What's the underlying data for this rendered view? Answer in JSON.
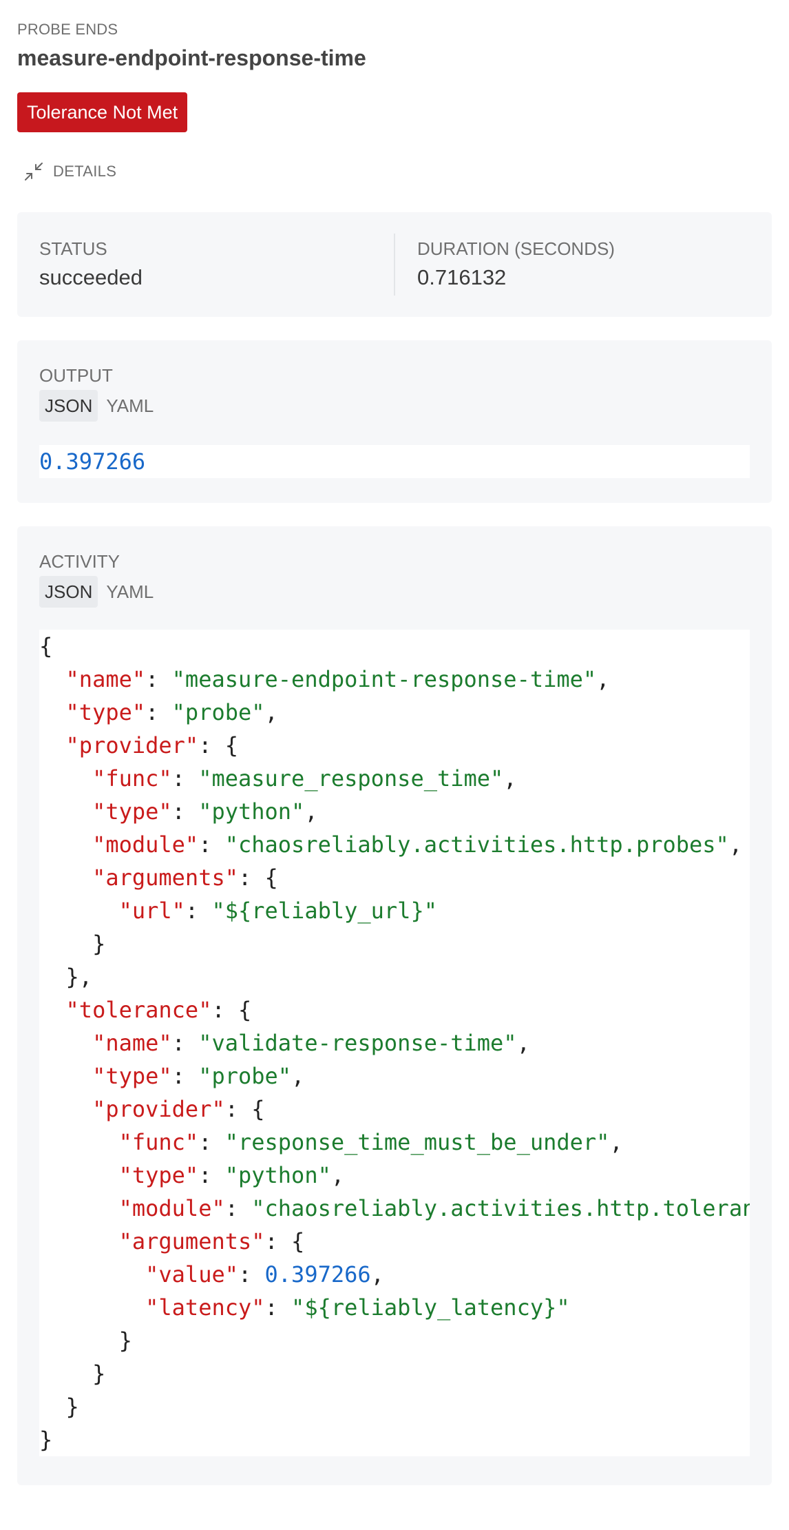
{
  "header": {
    "kicker": "PROBE ENDS",
    "title": "measure-endpoint-response-time",
    "badge": "Tolerance Not Met"
  },
  "details_toggle": {
    "label": "DETAILS",
    "icon": "collapse-arrows-icon"
  },
  "stats": {
    "status_label": "STATUS",
    "status_value": "succeeded",
    "duration_label": "DURATION (SECONDS)",
    "duration_value": "0.716132"
  },
  "output": {
    "label": "OUTPUT",
    "tabs": [
      "JSON",
      "YAML"
    ],
    "active_tab": "JSON",
    "value": "0.397266"
  },
  "activity": {
    "label": "ACTIVITY",
    "tabs": [
      "JSON",
      "YAML"
    ],
    "active_tab": "JSON",
    "code_lines": [
      [
        {
          "t": "{",
          "c": "p"
        }
      ],
      [
        {
          "t": "  ",
          "c": "p"
        },
        {
          "t": "\"name\"",
          "c": "k"
        },
        {
          "t": ": ",
          "c": "p"
        },
        {
          "t": "\"measure-endpoint-response-time\"",
          "c": "s"
        },
        {
          "t": ",",
          "c": "p"
        }
      ],
      [
        {
          "t": "  ",
          "c": "p"
        },
        {
          "t": "\"type\"",
          "c": "k"
        },
        {
          "t": ": ",
          "c": "p"
        },
        {
          "t": "\"probe\"",
          "c": "s"
        },
        {
          "t": ",",
          "c": "p"
        }
      ],
      [
        {
          "t": "  ",
          "c": "p"
        },
        {
          "t": "\"provider\"",
          "c": "k"
        },
        {
          "t": ": {",
          "c": "p"
        }
      ],
      [
        {
          "t": "    ",
          "c": "p"
        },
        {
          "t": "\"func\"",
          "c": "k"
        },
        {
          "t": ": ",
          "c": "p"
        },
        {
          "t": "\"measure_response_time\"",
          "c": "s"
        },
        {
          "t": ",",
          "c": "p"
        }
      ],
      [
        {
          "t": "    ",
          "c": "p"
        },
        {
          "t": "\"type\"",
          "c": "k"
        },
        {
          "t": ": ",
          "c": "p"
        },
        {
          "t": "\"python\"",
          "c": "s"
        },
        {
          "t": ",",
          "c": "p"
        }
      ],
      [
        {
          "t": "    ",
          "c": "p"
        },
        {
          "t": "\"module\"",
          "c": "k"
        },
        {
          "t": ": ",
          "c": "p"
        },
        {
          "t": "\"chaosreliably.activities.http.probes\"",
          "c": "s"
        },
        {
          "t": ",",
          "c": "p"
        }
      ],
      [
        {
          "t": "    ",
          "c": "p"
        },
        {
          "t": "\"arguments\"",
          "c": "k"
        },
        {
          "t": ": {",
          "c": "p"
        }
      ],
      [
        {
          "t": "      ",
          "c": "p"
        },
        {
          "t": "\"url\"",
          "c": "k"
        },
        {
          "t": ": ",
          "c": "p"
        },
        {
          "t": "\"${reliably_url}\"",
          "c": "s"
        }
      ],
      [
        {
          "t": "    }",
          "c": "p"
        }
      ],
      [
        {
          "t": "  },",
          "c": "p"
        }
      ],
      [
        {
          "t": "  ",
          "c": "p"
        },
        {
          "t": "\"tolerance\"",
          "c": "k"
        },
        {
          "t": ": {",
          "c": "p"
        }
      ],
      [
        {
          "t": "    ",
          "c": "p"
        },
        {
          "t": "\"name\"",
          "c": "k"
        },
        {
          "t": ": ",
          "c": "p"
        },
        {
          "t": "\"validate-response-time\"",
          "c": "s"
        },
        {
          "t": ",",
          "c": "p"
        }
      ],
      [
        {
          "t": "    ",
          "c": "p"
        },
        {
          "t": "\"type\"",
          "c": "k"
        },
        {
          "t": ": ",
          "c": "p"
        },
        {
          "t": "\"probe\"",
          "c": "s"
        },
        {
          "t": ",",
          "c": "p"
        }
      ],
      [
        {
          "t": "    ",
          "c": "p"
        },
        {
          "t": "\"provider\"",
          "c": "k"
        },
        {
          "t": ": {",
          "c": "p"
        }
      ],
      [
        {
          "t": "      ",
          "c": "p"
        },
        {
          "t": "\"func\"",
          "c": "k"
        },
        {
          "t": ": ",
          "c": "p"
        },
        {
          "t": "\"response_time_must_be_under\"",
          "c": "s"
        },
        {
          "t": ",",
          "c": "p"
        }
      ],
      [
        {
          "t": "      ",
          "c": "p"
        },
        {
          "t": "\"type\"",
          "c": "k"
        },
        {
          "t": ": ",
          "c": "p"
        },
        {
          "t": "\"python\"",
          "c": "s"
        },
        {
          "t": ",",
          "c": "p"
        }
      ],
      [
        {
          "t": "      ",
          "c": "p"
        },
        {
          "t": "\"module\"",
          "c": "k"
        },
        {
          "t": ": ",
          "c": "p"
        },
        {
          "t": "\"chaosreliably.activities.http.toleran",
          "c": "s"
        }
      ],
      [
        {
          "t": "      ",
          "c": "p"
        },
        {
          "t": "\"arguments\"",
          "c": "k"
        },
        {
          "t": ": {",
          "c": "p"
        }
      ],
      [
        {
          "t": "        ",
          "c": "p"
        },
        {
          "t": "\"value\"",
          "c": "k"
        },
        {
          "t": ": ",
          "c": "p"
        },
        {
          "t": "0.397266",
          "c": "n"
        },
        {
          "t": ",",
          "c": "p"
        }
      ],
      [
        {
          "t": "        ",
          "c": "p"
        },
        {
          "t": "\"latency\"",
          "c": "k"
        },
        {
          "t": ": ",
          "c": "p"
        },
        {
          "t": "\"${reliably_latency}\"",
          "c": "s"
        }
      ],
      [
        {
          "t": "      }",
          "c": "p"
        }
      ],
      [
        {
          "t": "    }",
          "c": "p"
        }
      ],
      [
        {
          "t": "  }",
          "c": "p"
        }
      ],
      [
        {
          "t": "}",
          "c": "p"
        }
      ]
    ]
  },
  "colors": {
    "badge_bg": "#c7181e",
    "json_key": "#c91b1b",
    "json_string": "#1c7c2e",
    "json_number": "#1868c9",
    "panel_bg": "#f6f7f9"
  }
}
